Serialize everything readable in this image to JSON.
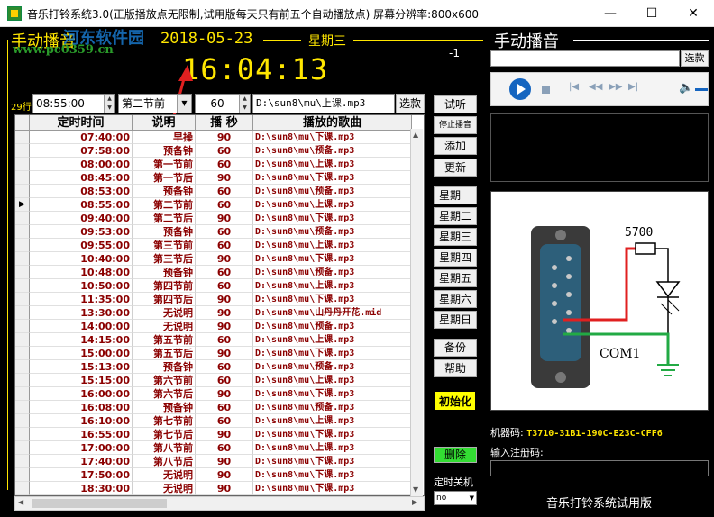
{
  "window": {
    "title": "音乐打铃系统3.0(正版播放点无限制,试用版每天只有前五个自动播放点) 屏幕分辨率:800x600",
    "minimize": "—",
    "maximize": "☐",
    "close": "✕"
  },
  "header": {
    "manual_label": "手动播音",
    "date": "2018-05-23",
    "weekday": "星期三",
    "indicator": "-1",
    "clock": "16:04:13",
    "watermark_url": "www.pc0359.cn",
    "watermark_site": "河东软件园"
  },
  "editor": {
    "row_count": "29行",
    "time_value": "08:55:00",
    "period_value": "第二节前",
    "seconds_value": "60",
    "path_value": "D:\\sun8\\mu\\上课.mp3",
    "browse_button": "选款"
  },
  "table": {
    "columns": [
      "定时时间",
      "说明",
      "播 秒",
      "播放的歌曲"
    ],
    "selected_index": 5,
    "rows": [
      [
        "07:40:00",
        "早操",
        "90",
        "D:\\sun8\\mu\\下课.mp3"
      ],
      [
        "07:58:00",
        "预备钟",
        "60",
        "D:\\sun8\\mu\\预备.mp3"
      ],
      [
        "08:00:00",
        "第一节前",
        "60",
        "D:\\sun8\\mu\\上课.mp3"
      ],
      [
        "08:45:00",
        "第一节后",
        "90",
        "D:\\sun8\\mu\\下课.mp3"
      ],
      [
        "08:53:00",
        "预备钟",
        "60",
        "D:\\sun8\\mu\\预备.mp3"
      ],
      [
        "08:55:00",
        "第二节前",
        "60",
        "D:\\sun8\\mu\\上课.mp3"
      ],
      [
        "09:40:00",
        "第二节后",
        "90",
        "D:\\sun8\\mu\\下课.mp3"
      ],
      [
        "09:53:00",
        "预备钟",
        "60",
        "D:\\sun8\\mu\\预备.mp3"
      ],
      [
        "09:55:00",
        "第三节前",
        "60",
        "D:\\sun8\\mu\\上课.mp3"
      ],
      [
        "10:40:00",
        "第三节后",
        "90",
        "D:\\sun8\\mu\\下课.mp3"
      ],
      [
        "10:48:00",
        "预备钟",
        "60",
        "D:\\sun8\\mu\\预备.mp3"
      ],
      [
        "10:50:00",
        "第四节前",
        "60",
        "D:\\sun8\\mu\\上课.mp3"
      ],
      [
        "11:35:00",
        "第四节后",
        "90",
        "D:\\sun8\\mu\\下课.mp3"
      ],
      [
        "13:30:00",
        "无说明",
        "90",
        "D:\\sun8\\mu\\山丹丹开花.mid"
      ],
      [
        "14:00:00",
        "无说明",
        "90",
        "D:\\sun8\\mu\\预备.mp3"
      ],
      [
        "14:15:00",
        "第五节前",
        "60",
        "D:\\sun8\\mu\\上课.mp3"
      ],
      [
        "15:00:00",
        "第五节后",
        "90",
        "D:\\sun8\\mu\\下课.mp3"
      ],
      [
        "15:13:00",
        "预备钟",
        "60",
        "D:\\sun8\\mu\\预备.mp3"
      ],
      [
        "15:15:00",
        "第六节前",
        "60",
        "D:\\sun8\\mu\\上课.mp3"
      ],
      [
        "16:00:00",
        "第六节后",
        "90",
        "D:\\sun8\\mu\\下课.mp3"
      ],
      [
        "16:08:00",
        "预备钟",
        "60",
        "D:\\sun8\\mu\\预备.mp3"
      ],
      [
        "16:10:00",
        "第七节前",
        "60",
        "D:\\sun8\\mu\\上课.mp3"
      ],
      [
        "16:55:00",
        "第七节后",
        "90",
        "D:\\sun8\\mu\\下课.mp3"
      ],
      [
        "17:00:00",
        "第八节前",
        "60",
        "D:\\sun8\\mu\\上课.mp3"
      ],
      [
        "17:40:00",
        "第八节后",
        "90",
        "D:\\sun8\\mu\\下课.mp3"
      ],
      [
        "17:50:00",
        "无说明",
        "90",
        "D:\\sun8\\mu\\下课.mp3"
      ],
      [
        "18:30:00",
        "无说明",
        "90",
        "D:\\sun8\\mu\\下课.mp3"
      ]
    ]
  },
  "actions": {
    "listen": "试听",
    "stop": "停止播音",
    "add": "添加",
    "update": "更新",
    "mon": "星期一",
    "tue": "星期二",
    "wed": "星期三",
    "thu": "星期四",
    "fri": "星期五",
    "sat": "星期六",
    "sun": "星期日",
    "backup": "备份",
    "help": "帮助",
    "init": "初始化",
    "delete": "删除",
    "shutdown_label": "定时关机",
    "shutdown_value": "no"
  },
  "right_panel": {
    "title": "手动播音",
    "browse_button": "选款",
    "resistor_label": "5700",
    "com_label": "COM1",
    "machine_label": "机器码:",
    "machine_code": "T3710-31B1-190C-E23C-CFF6",
    "register_label": "输入注册码:",
    "trial_text": "音乐打铃系统试用版"
  },
  "colors": {
    "accent": "#ffe600",
    "table_text": "#8b0000",
    "init_button": "#ffff00",
    "delete_button": "#33dd33"
  }
}
